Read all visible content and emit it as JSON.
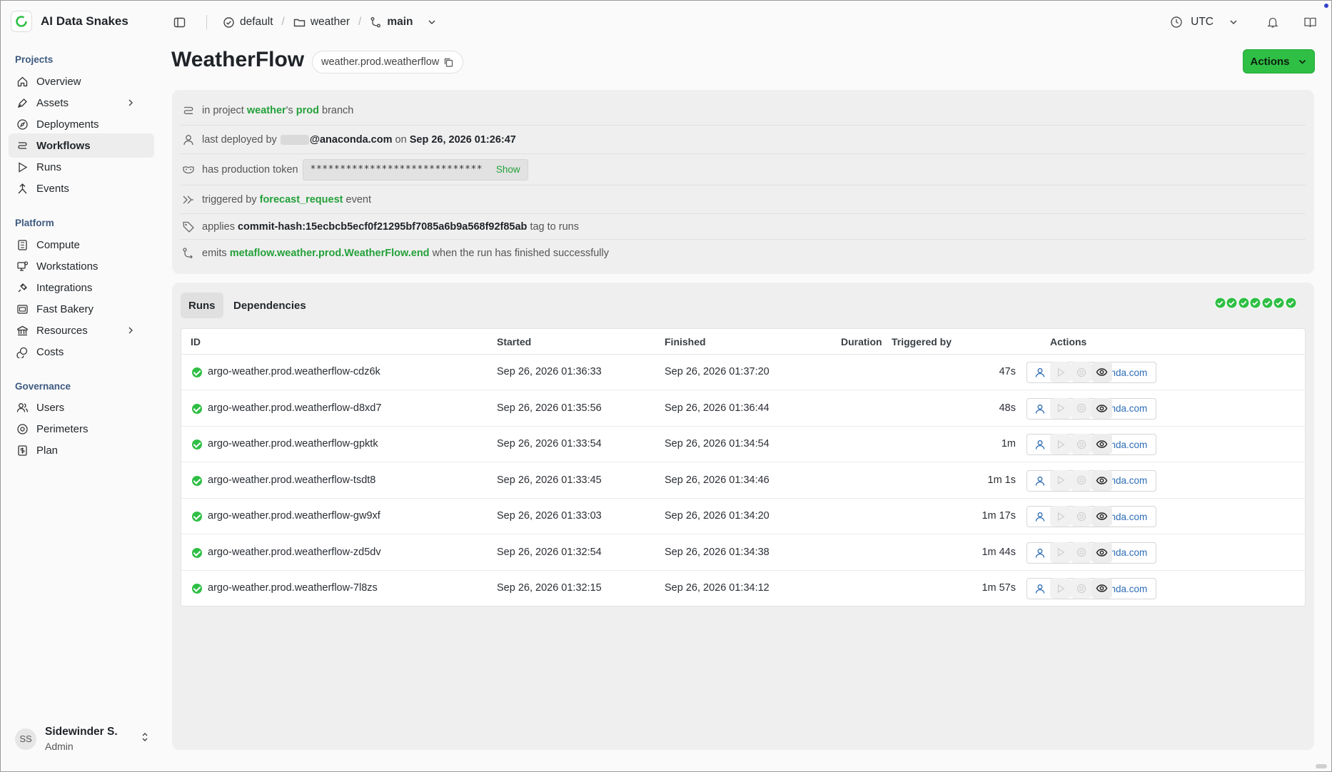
{
  "app": {
    "name": "AI Data Snakes"
  },
  "breadcrumb": {
    "org": "default",
    "project": "weather",
    "branch": "main"
  },
  "topbar": {
    "timezone": "UTC"
  },
  "sidebar": {
    "projects_label": "Projects",
    "projects": [
      "Overview",
      "Assets",
      "Deployments",
      "Workflows",
      "Runs",
      "Events"
    ],
    "platform_label": "Platform",
    "platform": [
      "Compute",
      "Workstations",
      "Integrations",
      "Fast Bakery",
      "Resources",
      "Costs"
    ],
    "governance_label": "Governance",
    "governance": [
      "Users",
      "Perimeters",
      "Plan"
    ],
    "active": "Workflows"
  },
  "user": {
    "initials": "SS",
    "name": "Sidewinder S.",
    "role": "Admin"
  },
  "page": {
    "title": "WeatherFlow",
    "slug": "weather.prod.weatherflow",
    "actions_label": "Actions"
  },
  "info": {
    "project_prefix": "in project",
    "project": "weather",
    "project_suffix": "'s",
    "branch": "prod",
    "branch_suffix": "branch",
    "deployed_prefix": "last deployed by",
    "deployed_by": "@anaconda.com",
    "deployed_on_word": "on",
    "deployed_at": "Sep 26, 2026 01:26:47",
    "token_prefix": "has production token",
    "token_value": "*****************************",
    "token_show": "Show",
    "trigger_prefix": "triggered by",
    "trigger_event": "forecast_request",
    "trigger_suffix": "event",
    "tag_prefix": "applies",
    "tag": "commit-hash:15ecbcb5ecf0f21295bf7085a6b9a568f92f85ab",
    "tag_suffix": "tag to runs",
    "emits_prefix": "emits",
    "emits_event": "metaflow.weather.prod.WeatherFlow.end",
    "emits_suffix": "when the run has finished successfully"
  },
  "tabs": {
    "runs": "Runs",
    "dependencies": "Dependencies"
  },
  "status_strip": [
    "success",
    "success",
    "success",
    "success",
    "success",
    "success",
    "success"
  ],
  "table": {
    "headers": {
      "id": "ID",
      "started": "Started",
      "finished": "Finished",
      "duration": "Duration",
      "triggered_by": "Triggered by",
      "actions": "Actions"
    },
    "rows": [
      {
        "id": "argo-weather.prod.weatherflow-cdz6k",
        "started": "Sep 26, 2026 01:36:33",
        "finished": "Sep 26, 2026 01:37:20",
        "duration": "47s",
        "user": "@anaconda.com"
      },
      {
        "id": "argo-weather.prod.weatherflow-d8xd7",
        "started": "Sep 26, 2026 01:35:56",
        "finished": "Sep 26, 2026 01:36:44",
        "duration": "48s",
        "user": "@anaconda.com"
      },
      {
        "id": "argo-weather.prod.weatherflow-gpktk",
        "started": "Sep 26, 2026 01:33:54",
        "finished": "Sep 26, 2026 01:34:54",
        "duration": "1m",
        "user": "@anaconda.com"
      },
      {
        "id": "argo-weather.prod.weatherflow-tsdt8",
        "started": "Sep 26, 2026 01:33:45",
        "finished": "Sep 26, 2026 01:34:46",
        "duration": "1m 1s",
        "user": "@anaconda.com"
      },
      {
        "id": "argo-weather.prod.weatherflow-gw9xf",
        "started": "Sep 26, 2026 01:33:03",
        "finished": "Sep 26, 2026 01:34:20",
        "duration": "1m 17s",
        "user": "@anaconda.com"
      },
      {
        "id": "argo-weather.prod.weatherflow-zd5dv",
        "started": "Sep 26, 2026 01:32:54",
        "finished": "Sep 26, 2026 01:34:38",
        "duration": "1m 44s",
        "user": "@anaconda.com"
      },
      {
        "id": "argo-weather.prod.weatherflow-7l8zs",
        "started": "Sep 26, 2026 01:32:15",
        "finished": "Sep 26, 2026 01:34:12",
        "duration": "1m 57s",
        "user": "@anaconda.com"
      }
    ]
  },
  "colors": {
    "accent": "#2fbf45",
    "link": "#24a13a",
    "user_link": "#2d6db5",
    "section_label": "#3d5a80"
  }
}
